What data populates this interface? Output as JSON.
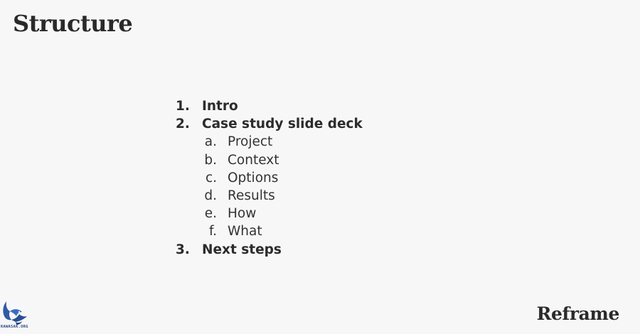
{
  "slide": {
    "title": "Structure",
    "brand": "Reframe"
  },
  "outline": {
    "items": [
      {
        "marker": "1.",
        "text": "Intro"
      },
      {
        "marker": "2.",
        "text": "Case study slide deck"
      },
      {
        "marker": "3.",
        "text": "Next steps"
      }
    ],
    "subitems": [
      {
        "marker": "a.",
        "text": "Project"
      },
      {
        "marker": "b.",
        "text": "Context"
      },
      {
        "marker": "c.",
        "text": "Options"
      },
      {
        "marker": "d.",
        "text": "Results"
      },
      {
        "marker": "e.",
        "text": "How"
      },
      {
        "marker": "f.",
        "text": "What"
      }
    ]
  },
  "watermark": {
    "text": "KAWASAK.ORG",
    "icon": "bird-logo-icon",
    "color": "#2f5aa8"
  }
}
